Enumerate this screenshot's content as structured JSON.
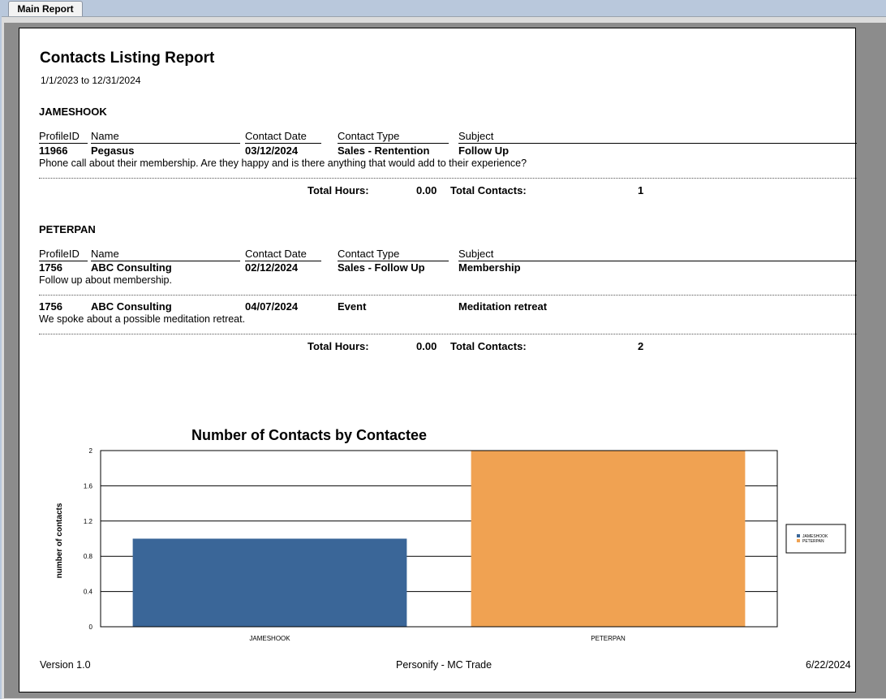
{
  "tab": {
    "label": "Main Report"
  },
  "report": {
    "title": "Contacts Listing Report",
    "date_range": "1/1/2023 to 12/31/2024",
    "columns": {
      "profile_id": "ProfileID",
      "name": "Name",
      "contact_date": "Contact Date",
      "contact_type": "Contact Type",
      "subject": "Subject"
    },
    "total_hours_label": "Total Hours:",
    "total_contacts_label": "Total Contacts:",
    "groups": [
      {
        "name": "JAMESHOOK",
        "records": [
          {
            "profile_id": "11966",
            "name": "Pegasus",
            "contact_date": "03/12/2024",
            "contact_type": "Sales - Rentention",
            "subject": "Follow Up",
            "note": "Phone call about their membership. Are they happy and is there anything that would add to their experience?"
          }
        ],
        "total_hours": "0.00",
        "total_contacts": "1"
      },
      {
        "name": "PETERPAN",
        "records": [
          {
            "profile_id": "1756",
            "name": "ABC Consulting",
            "contact_date": "02/12/2024",
            "contact_type": "Sales - Follow Up",
            "subject": "Membership",
            "note": "Follow up about membership."
          },
          {
            "profile_id": "1756",
            "name": "ABC Consulting",
            "contact_date": "04/07/2024",
            "contact_type": "Event",
            "subject": "Meditation retreat",
            "note": "We spoke about a possible meditation retreat."
          }
        ],
        "total_hours": "0.00",
        "total_contacts": "2"
      }
    ],
    "footer": {
      "version": "Version 1.0",
      "center": "Personify - MC Trade",
      "date": "6/22/2024"
    }
  },
  "chart_data": {
    "type": "bar",
    "title": "Number of Contacts by Contactee",
    "xlabel": "",
    "ylabel": "number of contacts",
    "categories": [
      "JAMESHOOK",
      "PETERPAN"
    ],
    "values": [
      1,
      2
    ],
    "colors": [
      "#3a6698",
      "#f0a252"
    ],
    "ylim": [
      0,
      2
    ],
    "yticks": [
      "0",
      "0.4",
      "0.8",
      "1.2",
      "1.6",
      "2"
    ],
    "grid": true,
    "legend": {
      "placement": "right",
      "entries": [
        "JAMESHOOK",
        "PETERPAN"
      ]
    }
  }
}
